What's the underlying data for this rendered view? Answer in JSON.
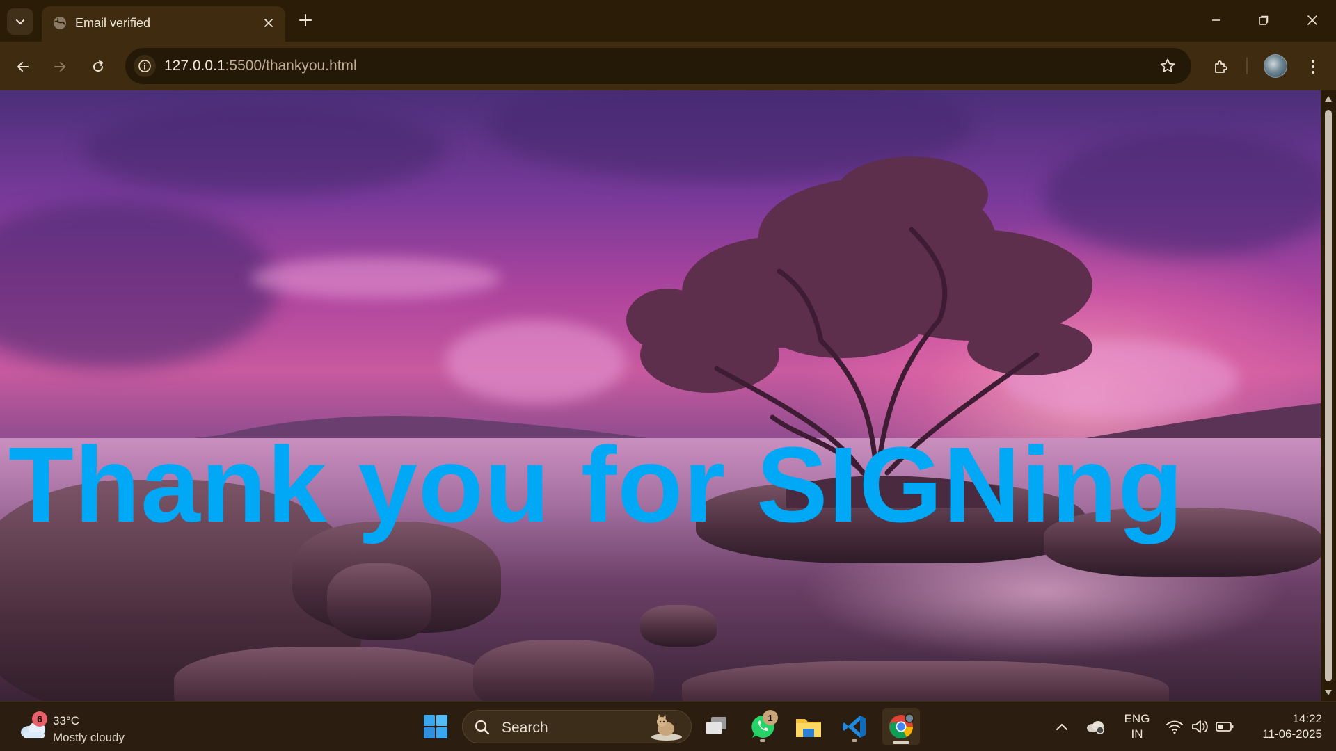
{
  "browser": {
    "tab": {
      "title": "Email verified"
    },
    "url": {
      "host": "127.0.0.1",
      "path": ":5500/thankyou.html"
    }
  },
  "page": {
    "headline": "Thank you for SIGNing"
  },
  "taskbar": {
    "weather": {
      "badge": "6",
      "temp": "33°C",
      "desc": "Mostly cloudy"
    },
    "search": {
      "placeholder": "Search"
    },
    "whatsapp_badge": "1",
    "language": {
      "line1": "ENG",
      "line2": "IN"
    },
    "clock": {
      "time": "14:22",
      "date": "11-06-2025"
    }
  },
  "colors": {
    "headline": "#00a8f5",
    "chrome_bg": "#2a1c07",
    "toolbar_bg": "#3f2c10"
  },
  "icons": [
    "tab-search-icon",
    "globe-icon",
    "close-icon",
    "plus-icon",
    "minimize-icon",
    "restore-icon",
    "window-close-icon",
    "back-arrow-icon",
    "forward-arrow-icon",
    "reload-icon",
    "info-icon",
    "star-icon",
    "extensions-icon",
    "profile-avatar",
    "kebab-menu-icon",
    "weather-cloud-icon",
    "windows-start-icon",
    "search-icon",
    "task-view-icon",
    "whatsapp-icon",
    "file-explorer-icon",
    "vscode-icon",
    "chrome-icon",
    "chevron-up-icon",
    "onedrive-icon",
    "wifi-icon",
    "volume-icon",
    "battery-icon"
  ]
}
